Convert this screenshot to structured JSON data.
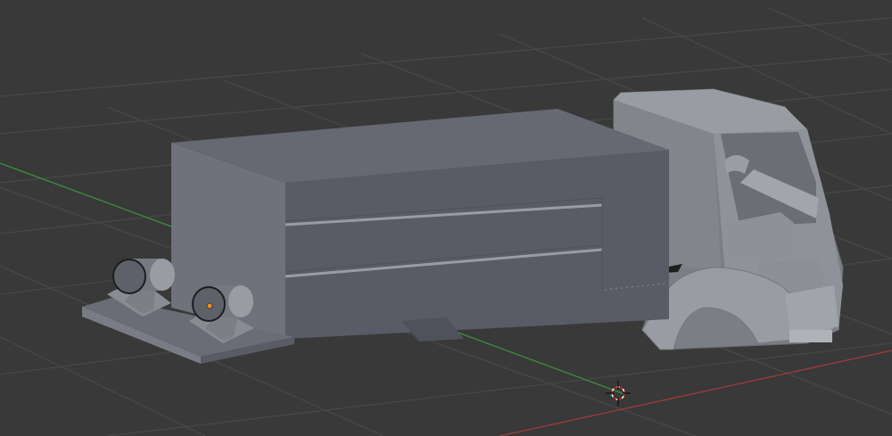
{
  "viewport": {
    "name": "3D Viewport",
    "background": "#393939",
    "grid_color": "#474747",
    "x_axis_color": "#a13b3b",
    "y_axis_color": "#3b8f3b"
  },
  "scene": {
    "object": "truck-model",
    "box_color": "#636670",
    "cab_color": "#8a8c94",
    "origin_color": "#f08c1c",
    "cursor_icon": "3d-cursor-icon"
  }
}
